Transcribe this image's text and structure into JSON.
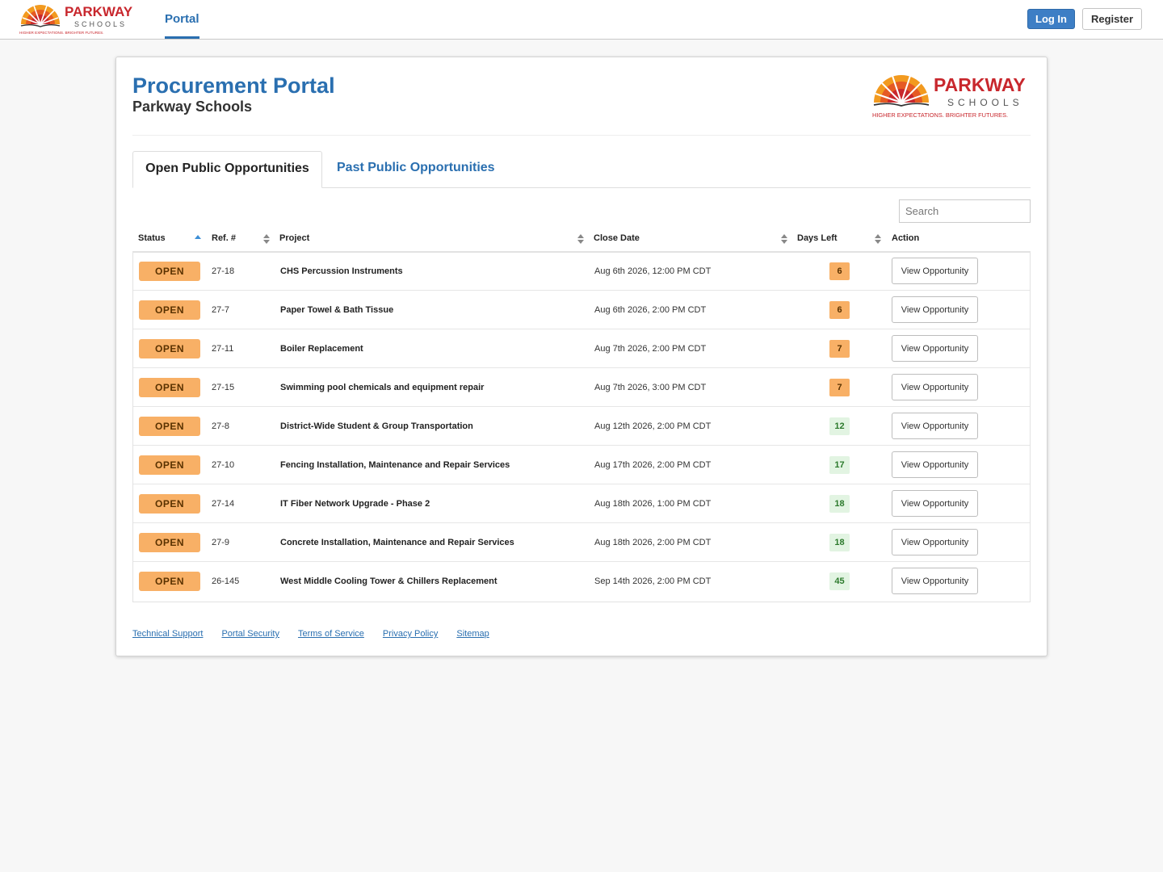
{
  "header": {
    "logo": {
      "name": "PARKWAY",
      "sub": "SCHOOLS",
      "tagline": "HIGHER EXPECTATIONS. BRIGHTER FUTURES."
    },
    "nav_portal": "Portal",
    "login_label": "Log In",
    "register_label": "Register"
  },
  "page": {
    "title": "Procurement Portal",
    "subtitle": "Parkway Schools",
    "logo": {
      "name": "PARKWAY",
      "sub": "SCHOOLS",
      "tagline": "HIGHER EXPECTATIONS. BRIGHTER FUTURES."
    }
  },
  "tabs": {
    "open": "Open Public Opportunities",
    "past": "Past Public Opportunities"
  },
  "search": {
    "placeholder": "Search"
  },
  "table": {
    "headers": {
      "status": "Status",
      "ref": "Ref. #",
      "project": "Project",
      "close_date": "Close Date",
      "days_left": "Days Left",
      "action": "Action"
    },
    "status_label": "OPEN",
    "action_label": "View Opportunity",
    "rows": [
      {
        "ref": "27-18",
        "project": "CHS Percussion Instruments",
        "close": "Aug 6th 2026, 12:00 PM CDT",
        "days": "6"
      },
      {
        "ref": "27-7",
        "project": "Paper Towel & Bath Tissue",
        "close": "Aug 6th 2026, 2:00 PM CDT",
        "days": "6"
      },
      {
        "ref": "27-11",
        "project": "Boiler Replacement",
        "close": "Aug 7th 2026, 2:00 PM CDT",
        "days": "7"
      },
      {
        "ref": "27-15",
        "project": "Swimming pool chemicals and equipment repair",
        "close": "Aug 7th 2026, 3:00 PM CDT",
        "days": "7"
      },
      {
        "ref": "27-8",
        "project": "District-Wide Student & Group Transportation",
        "close": "Aug 12th 2026, 2:00 PM CDT",
        "days": "12"
      },
      {
        "ref": "27-10",
        "project": "Fencing Installation, Maintenance and Repair Services",
        "close": "Aug 17th 2026, 2:00 PM CDT",
        "days": "17"
      },
      {
        "ref": "27-14",
        "project": "IT Fiber Network Upgrade - Phase 2",
        "close": "Aug 18th 2026, 1:00 PM CDT",
        "days": "18"
      },
      {
        "ref": "27-9",
        "project": "Concrete Installation, Maintenance and Repair Services",
        "close": "Aug 18th 2026, 2:00 PM CDT",
        "days": "18"
      },
      {
        "ref": "26-145",
        "project": "West Middle Cooling Tower & Chillers Replacement",
        "close": "Sep 14th 2026, 2:00 PM CDT",
        "days": "45"
      }
    ]
  },
  "footer": {
    "links": [
      "Technical Support",
      "Portal Security",
      "Terms of Service",
      "Privacy Policy",
      "Sitemap"
    ]
  },
  "colors": {
    "brand_blue": "#2a6fb0",
    "open_orange": "#f8b066",
    "days_ok_green": "#e2f4e2",
    "logo_red": "#c8272d"
  }
}
